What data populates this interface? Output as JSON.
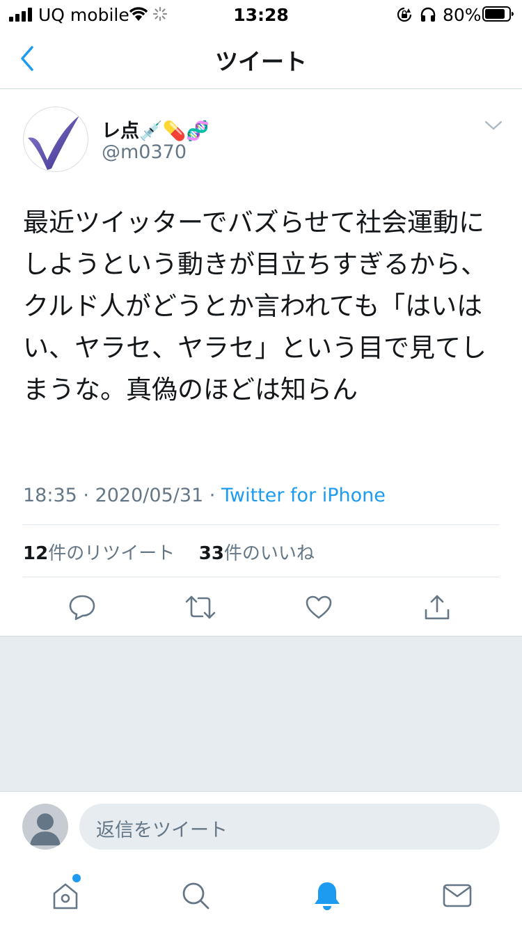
{
  "status_bar": {
    "carrier": "UQ mobile",
    "time": "13:28",
    "battery": "80%"
  },
  "nav": {
    "title": "ツイート"
  },
  "tweet": {
    "display_name": "レ点💉💊🧬",
    "handle": "@m0370",
    "text": "最近ツイッターでバズらせて社会運動にしようという動きが目立ちすぎるから、クルド人がどうとか言われても「はいはい、ヤラセ、ヤラセ」という目で見てしまうな。真偽のほどは知らん",
    "time": "18:35",
    "date": "2020/05/31",
    "source": "Twitter for iPhone"
  },
  "stats": {
    "retweets_count": "12",
    "retweets_label": "件のリツイート",
    "likes_count": "33",
    "likes_label": "件のいいね"
  },
  "reply": {
    "placeholder": "返信をツイート"
  },
  "colors": {
    "accent": "#1d9bf0",
    "secondary_text": "#657786",
    "background_gray": "#e6ecf0"
  }
}
